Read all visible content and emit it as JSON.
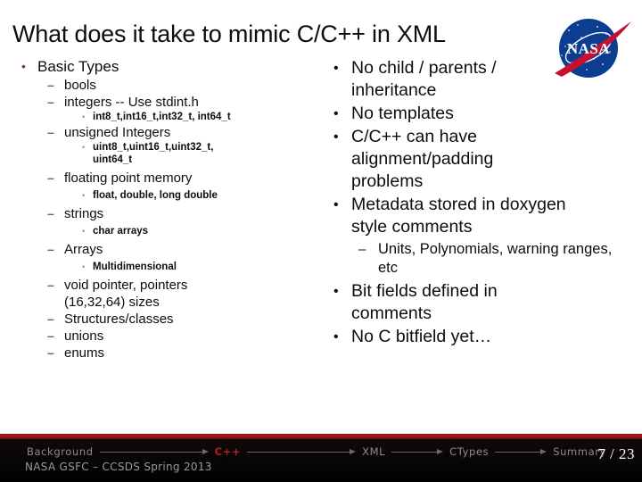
{
  "slide": {
    "title": "What does it take to mimic C/C++ in XML",
    "logo_alt": "nasa-meatball-logo"
  },
  "left_column": {
    "heading": "Basic Types",
    "items": [
      {
        "level": 2,
        "text": "bools"
      },
      {
        "level": 2,
        "text": "integers    -- Use stdint.h"
      },
      {
        "level": 3,
        "text": "int8_t,int16_t,int32_t,  int64_t"
      },
      {
        "level": 2,
        "text": "unsigned Integers"
      },
      {
        "level": 3,
        "text": "uint8_t,uint16_t,uint32_t, uint64_t"
      },
      {
        "level": 2,
        "text": "floating point memory"
      },
      {
        "level": 3,
        "text": "float, double, long double"
      },
      {
        "level": 2,
        "text": "strings"
      },
      {
        "level": 3,
        "text": "char arrays"
      },
      {
        "level": 2,
        "text": "Arrays"
      },
      {
        "level": 3,
        "text": "Multidimensional"
      },
      {
        "level": 2,
        "text": "void pointer, pointers (16,32,64) sizes"
      },
      {
        "level": 2,
        "text": "Structures/classes"
      },
      {
        "level": 2,
        "text": "unions"
      },
      {
        "level": 2,
        "text": "enums"
      }
    ]
  },
  "right_column": {
    "items": [
      {
        "level": 1,
        "text": "No child / parents / inheritance"
      },
      {
        "level": 1,
        "text": "No templates"
      },
      {
        "level": 1,
        "text": "C/C++ can have alignment/padding problems"
      },
      {
        "level": 1,
        "text": "Metadata stored in doxygen style comments"
      },
      {
        "level": 2,
        "text": "Units, Polynomials, warning ranges, etc"
      },
      {
        "level": 1,
        "text": "Bit fields defined in comments"
      },
      {
        "level": 1,
        "text": "No C bitfield yet…"
      }
    ]
  },
  "footer": {
    "nav": [
      {
        "label": "Background",
        "active": false
      },
      {
        "label": "C++",
        "active": true
      },
      {
        "label": "XML",
        "active": false
      },
      {
        "label": "CTypes",
        "active": false
      },
      {
        "label": "Summary",
        "active": false
      }
    ],
    "subtitle": "NASA GSFC – CCSDS Spring 2013",
    "page_number": "7 / 23"
  },
  "colors": {
    "accent_red": "#b02222",
    "rule_red": "#a51c1c",
    "footer_bg": "#0a0606",
    "bullet_l1": "#7b3a31",
    "bullet_l2": "#8a5a3b",
    "bullet_l3": "#7f91a6",
    "nasa_blue": "#0b3d91",
    "nasa_red": "#c8102e"
  },
  "glyphs": {
    "dot": "•",
    "dash": "–",
    "small_dot": "•"
  }
}
